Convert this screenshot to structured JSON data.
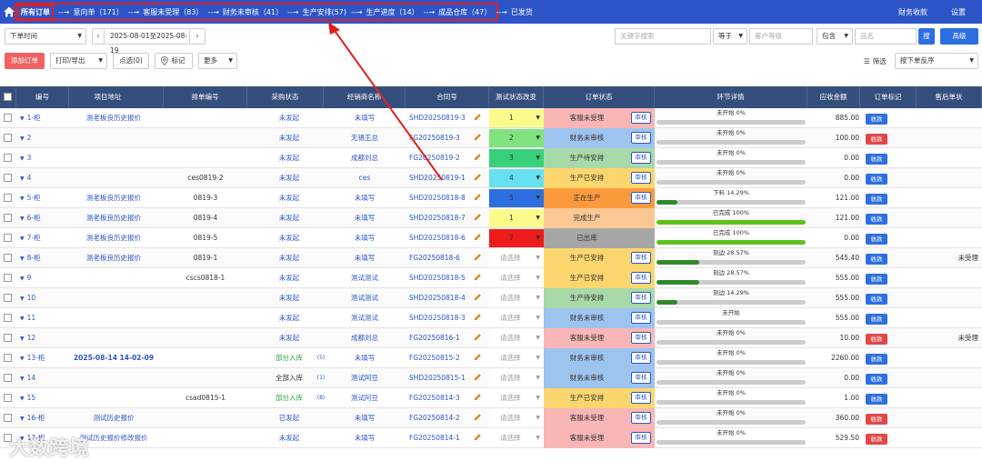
{
  "topbar": {
    "steps": [
      {
        "label": "所有订单",
        "count": ""
      },
      {
        "label": "意向单",
        "count": "（171）"
      },
      {
        "label": "客服未受理",
        "count": "（83）"
      },
      {
        "label": "财务未审核",
        "count": "（41）"
      },
      {
        "label": "生产安排",
        "count": "(57)"
      },
      {
        "label": "生产进度",
        "count": "（14）"
      },
      {
        "label": "成品仓库",
        "count": "（47）"
      },
      {
        "label": "已发货",
        "count": ""
      }
    ],
    "arrow": "--→",
    "finance": "财务收款",
    "settings": "设置"
  },
  "toolbar": {
    "time_select": "下单时间",
    "date_range": "2025-08-01至2025-08-19",
    "keyword_placeholder": "关键字搜索",
    "equal": "等于",
    "level_placeholder": "客户等级",
    "contains": "包含",
    "name_placeholder": "品名",
    "search_icon": "搜",
    "advanced": "高级",
    "add_order": "添加订单",
    "print_export": "打印/导出",
    "dot_select": "点选(0)",
    "mark": "标记",
    "more": "更多",
    "filter": "筛选",
    "sort": "按下单反序"
  },
  "headers": [
    "编号",
    "项目地址",
    "排单编号",
    "采购状态",
    "经销商名称",
    "合同号",
    "测试状态改变",
    "订单状态",
    "环节详情",
    "应收金额",
    "订单标记",
    "售后单状"
  ],
  "rows": [
    {
      "id": "1-柜",
      "addr": "测老板良历史报价",
      "sched": "",
      "purchase": "未发起",
      "pcolor": "blue",
      "dealer": "未填写",
      "contract": "SHD20250819-3",
      "test": "1",
      "tcolor": "#fbfb8c",
      "status": "客服未受理",
      "scolor": "#f9b6b6",
      "stage": "未开始 0%",
      "pct": 0,
      "fcolor": "#3aa82f",
      "amount": "885.00",
      "pay": "收款",
      "paycolor": "#2d6fe0",
      "after": ""
    },
    {
      "id": "2",
      "addr": "",
      "sched": "",
      "purchase": "未发起",
      "pcolor": "blue",
      "dealer": "无锡王总",
      "contract": "FG20250819-3",
      "test": "2",
      "tcolor": "#7fe27f",
      "status": "财务未审核",
      "scolor": "#9dc3ef",
      "stage": "未开始 0%",
      "pct": 0,
      "fcolor": "#3aa82f",
      "amount": "100.00",
      "pay": "收款",
      "paycolor": "#e04848",
      "after": ""
    },
    {
      "id": "3",
      "addr": "",
      "sched": "",
      "purchase": "未发起",
      "pcolor": "blue",
      "dealer": "成都刘总",
      "contract": "FG20250819-2",
      "test": "3",
      "tcolor": "#38d07a",
      "status": "生产待安排",
      "scolor": "#a8d9a8",
      "stage": "未开始 0%",
      "pct": 0,
      "fcolor": "#3aa82f",
      "amount": "0.00",
      "pay": "收款",
      "paycolor": "#2d6fe0",
      "after": ""
    },
    {
      "id": "4",
      "addr": "",
      "sched": "ces0819-2",
      "purchase": "未发起",
      "pcolor": "blue",
      "dealer": "ces",
      "contract": "SHD20250819-1",
      "test": "4",
      "tcolor": "#66e0f0",
      "status": "生产已安排",
      "scolor": "#fbd66e",
      "stage": "未开始 0%",
      "pct": 0,
      "fcolor": "#3aa82f",
      "amount": "0.00",
      "pay": "收款",
      "paycolor": "#2d6fe0",
      "after": ""
    },
    {
      "id": "5-柜",
      "addr": "测老板良历史报价",
      "sched": "0819-3",
      "purchase": "未发起",
      "pcolor": "blue",
      "dealer": "未填写",
      "contract": "SHD20250818-8",
      "test": "5",
      "tcolor": "#2d6fe0",
      "status": "正在生产",
      "scolor": "#fb9a3c",
      "stage": "下料 14.29%",
      "pct": 14.29,
      "fcolor": "#2f8a2a",
      "amount": "121.00",
      "pay": "收款",
      "paycolor": "#2d6fe0",
      "after": ""
    },
    {
      "id": "6-柜",
      "addr": "测老板良历史报价",
      "sched": "0819-4",
      "purchase": "未发起",
      "pcolor": "blue",
      "dealer": "未填写",
      "contract": "SHD20250818-7",
      "test": "1",
      "tcolor": "#fbfb8c",
      "status": "完成生产",
      "scolor": "#fbc794",
      "stage": "已完成 100%",
      "pct": 100,
      "fcolor": "#5cc21a",
      "amount": "121.00",
      "pay": "收款",
      "paycolor": "#2d6fe0",
      "after": ""
    },
    {
      "id": "7-柜",
      "addr": "测老板良历史报价",
      "sched": "0819-5",
      "purchase": "未发起",
      "pcolor": "blue",
      "dealer": "未填写",
      "contract": "SHD20250818-6",
      "test": "7",
      "tcolor": "#ee1c1c",
      "status": "已出库",
      "scolor": "#a6a6a6",
      "stage": "已完成 100%",
      "pct": 100,
      "fcolor": "#5cc21a",
      "amount": "0.00",
      "pay": "收款",
      "paycolor": "#2d6fe0",
      "after": ""
    },
    {
      "id": "8-柜",
      "addr": "测老板良历史报价",
      "sched": "0819-1",
      "purchase": "未发起",
      "pcolor": "blue",
      "dealer": "未填写",
      "contract": "FG20250818-6",
      "test": "请选择",
      "tcolor": "#ffffff",
      "status": "生产已安排",
      "scolor": "#fbd66e",
      "stage": "刻边 28.57%",
      "pct": 28.57,
      "fcolor": "#2f8a2a",
      "amount": "545.40",
      "pay": "收款",
      "paycolor": "#2d6fe0",
      "after": "未受理"
    },
    {
      "id": "9",
      "addr": "",
      "sched": "cscs0818-1",
      "purchase": "未发起",
      "pcolor": "blue",
      "dealer": "测试测试",
      "contract": "SHD20250818-5",
      "test": "请选择",
      "tcolor": "#ffffff",
      "status": "生产已安排",
      "scolor": "#fbd66e",
      "stage": "刻边 28.57%",
      "pct": 28.57,
      "fcolor": "#2f8a2a",
      "amount": "555.00",
      "pay": "收款",
      "paycolor": "#2d6fe0",
      "after": ""
    },
    {
      "id": "10",
      "addr": "",
      "sched": "",
      "purchase": "未发起",
      "pcolor": "blue",
      "dealer": "测试测试",
      "contract": "SHD20250818-4",
      "test": "请选择",
      "tcolor": "#ffffff",
      "status": "生产待安排",
      "scolor": "#a8d9a8",
      "stage": "刻边 14.29%",
      "pct": 14.29,
      "fcolor": "#2f8a2a",
      "amount": "555.00",
      "pay": "收款",
      "paycolor": "#2d6fe0",
      "after": ""
    },
    {
      "id": "11",
      "addr": "",
      "sched": "",
      "purchase": "未发起",
      "pcolor": "blue",
      "dealer": "测试测试",
      "contract": "SHD20250818-3",
      "test": "请选择",
      "tcolor": "#ffffff",
      "status": "财务未审核",
      "scolor": "#9dc3ef",
      "stage": "未开始",
      "pct": 0,
      "fcolor": "#3aa82f",
      "amount": "555.00",
      "pay": "收款",
      "paycolor": "#2d6fe0",
      "after": ""
    },
    {
      "id": "12",
      "addr": "",
      "sched": "",
      "purchase": "未发起",
      "pcolor": "blue",
      "dealer": "成都刘总",
      "contract": "FG20250816-1",
      "test": "请选择",
      "tcolor": "#ffffff",
      "status": "客服未受理",
      "scolor": "#f9b6b6",
      "stage": "未开始 0%",
      "pct": 0,
      "fcolor": "#3aa82f",
      "amount": "10.00",
      "pay": "收款",
      "paycolor": "#e04848",
      "after": "未受理"
    },
    {
      "id": "13-柜",
      "addr": "2025-08-14 14-02-09",
      "sched": "",
      "purchase": "部分入库",
      "pcolor": "green",
      "dealer": "未填写",
      "contract": "FG20250815-2",
      "test": "请选择",
      "tcolor": "#ffffff",
      "status": "财务未审核",
      "scolor": "#9dc3ef",
      "stage": "未开始 0%",
      "pct": 0,
      "fcolor": "#3aa82f",
      "amount": "2260.00",
      "pay": "收款",
      "paycolor": "#2d6fe0",
      "after": "",
      "badge": "(5)"
    },
    {
      "id": "14",
      "addr": "",
      "sched": "",
      "purchase": "全部入库",
      "pcolor": "dark",
      "dealer": "测试阿豆",
      "contract": "SHD20250815-1",
      "test": "请选择",
      "tcolor": "#ffffff",
      "status": "财务未审核",
      "scolor": "#9dc3ef",
      "stage": "未开始 0%",
      "pct": 0,
      "fcolor": "#3aa82f",
      "amount": "0.00",
      "pay": "收款",
      "paycolor": "#2d6fe0",
      "after": "",
      "badge": "(1)"
    },
    {
      "id": "15",
      "addr": "",
      "sched": "csad0815-1",
      "purchase": "部分入库",
      "pcolor": "green",
      "dealer": "测试阿豆",
      "contract": "FG20250814-3",
      "test": "请选择",
      "tcolor": "#ffffff",
      "status": "生产已安排",
      "scolor": "#fbd66e",
      "stage": "未开始 0%",
      "pct": 0,
      "fcolor": "#3aa82f",
      "amount": "1.00",
      "pay": "收款",
      "paycolor": "#2d6fe0",
      "after": "",
      "badge": "(8)"
    },
    {
      "id": "16-柜",
      "addr": "测试历史报价",
      "sched": "",
      "purchase": "已发起",
      "pcolor": "blue",
      "dealer": "未填写",
      "contract": "FG20250814-2",
      "test": "请选择",
      "tcolor": "#ffffff",
      "status": "客服未受理",
      "scolor": "#f9b6b6",
      "stage": "未开始 0%",
      "pct": 0,
      "fcolor": "#3aa82f",
      "amount": "360.00",
      "pay": "收款",
      "paycolor": "#e04848",
      "after": ""
    },
    {
      "id": "17-柜",
      "addr": "测试历史报价修改报价",
      "sched": "",
      "purchase": "未发起",
      "pcolor": "blue",
      "dealer": "未填写",
      "contract": "FG20250814-1",
      "test": "请选择",
      "tcolor": "#ffffff",
      "status": "客服未受理",
      "scolor": "#f9b6b6",
      "stage": "未开始 0%",
      "pct": 0,
      "fcolor": "#3aa82f",
      "amount": "529.50",
      "pay": "收款",
      "paycolor": "#e04848",
      "after": ""
    }
  ],
  "audit_label": "审核",
  "placeholder_select": "请选择",
  "watermark": "大数跨境"
}
